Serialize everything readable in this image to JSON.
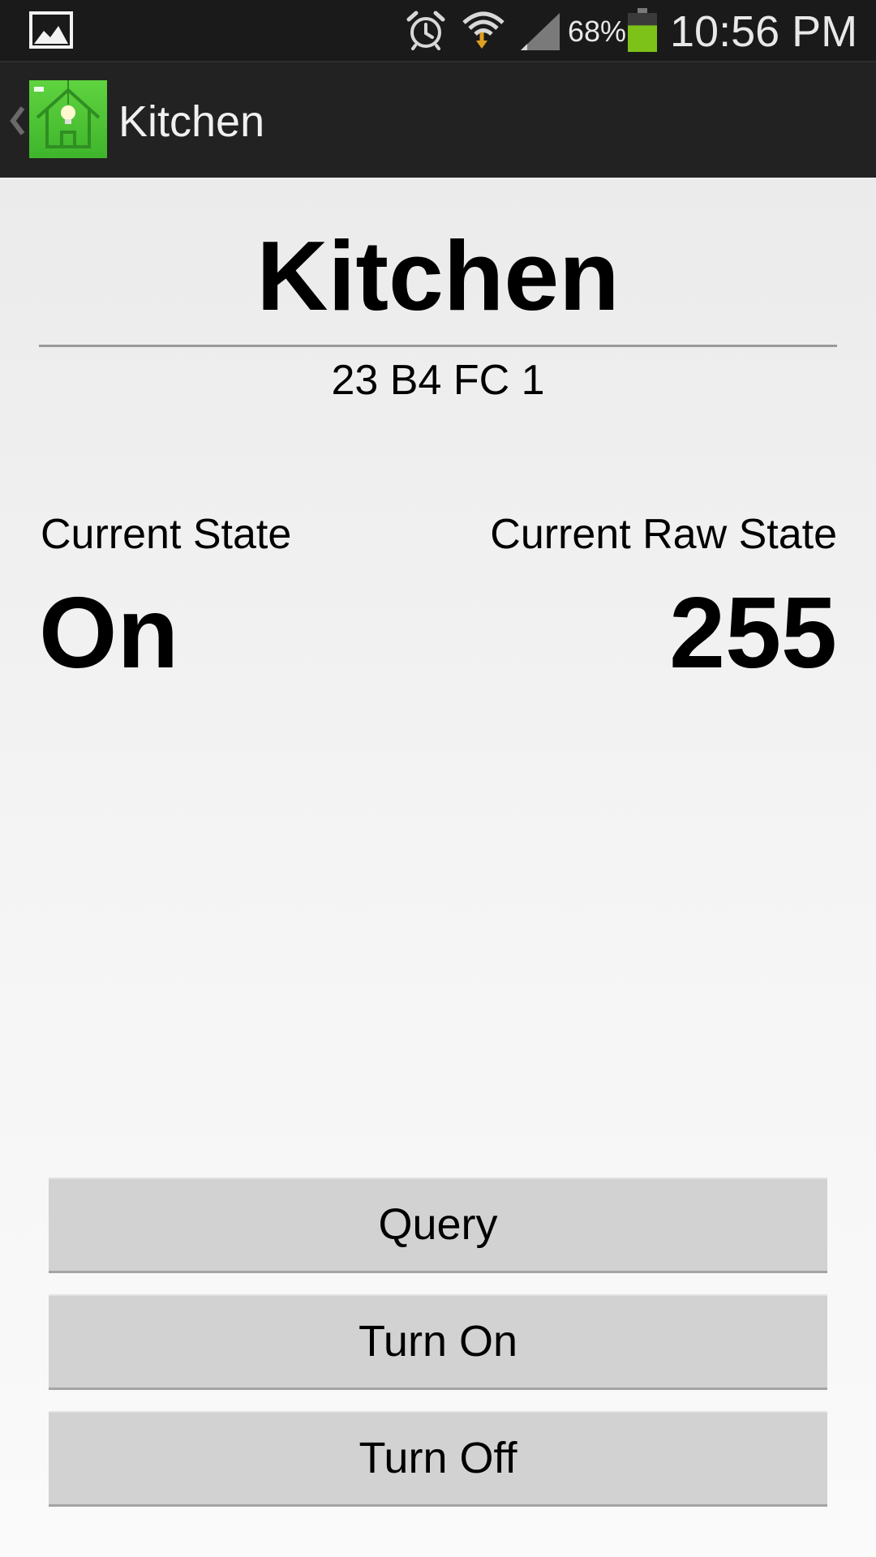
{
  "status_bar": {
    "battery_percent": "68%",
    "battery_level": 0.68,
    "time": "10:56 PM",
    "icons": [
      "gallery-icon",
      "alarm-icon",
      "wifi-icon",
      "signal-icon",
      "battery-icon"
    ],
    "battery_color": "#7cc218"
  },
  "action_bar": {
    "title": "Kitchen",
    "app_icon": "house-lightbulb-icon",
    "app_icon_color": "#4ec734"
  },
  "device": {
    "name": "Kitchen",
    "address": "23 B4 FC 1"
  },
  "state": {
    "label": "Current State",
    "value": "On"
  },
  "raw_state": {
    "label": "Current Raw State",
    "value": "255"
  },
  "buttons": {
    "query": "Query",
    "turn_on": "Turn On",
    "turn_off": "Turn Off"
  }
}
